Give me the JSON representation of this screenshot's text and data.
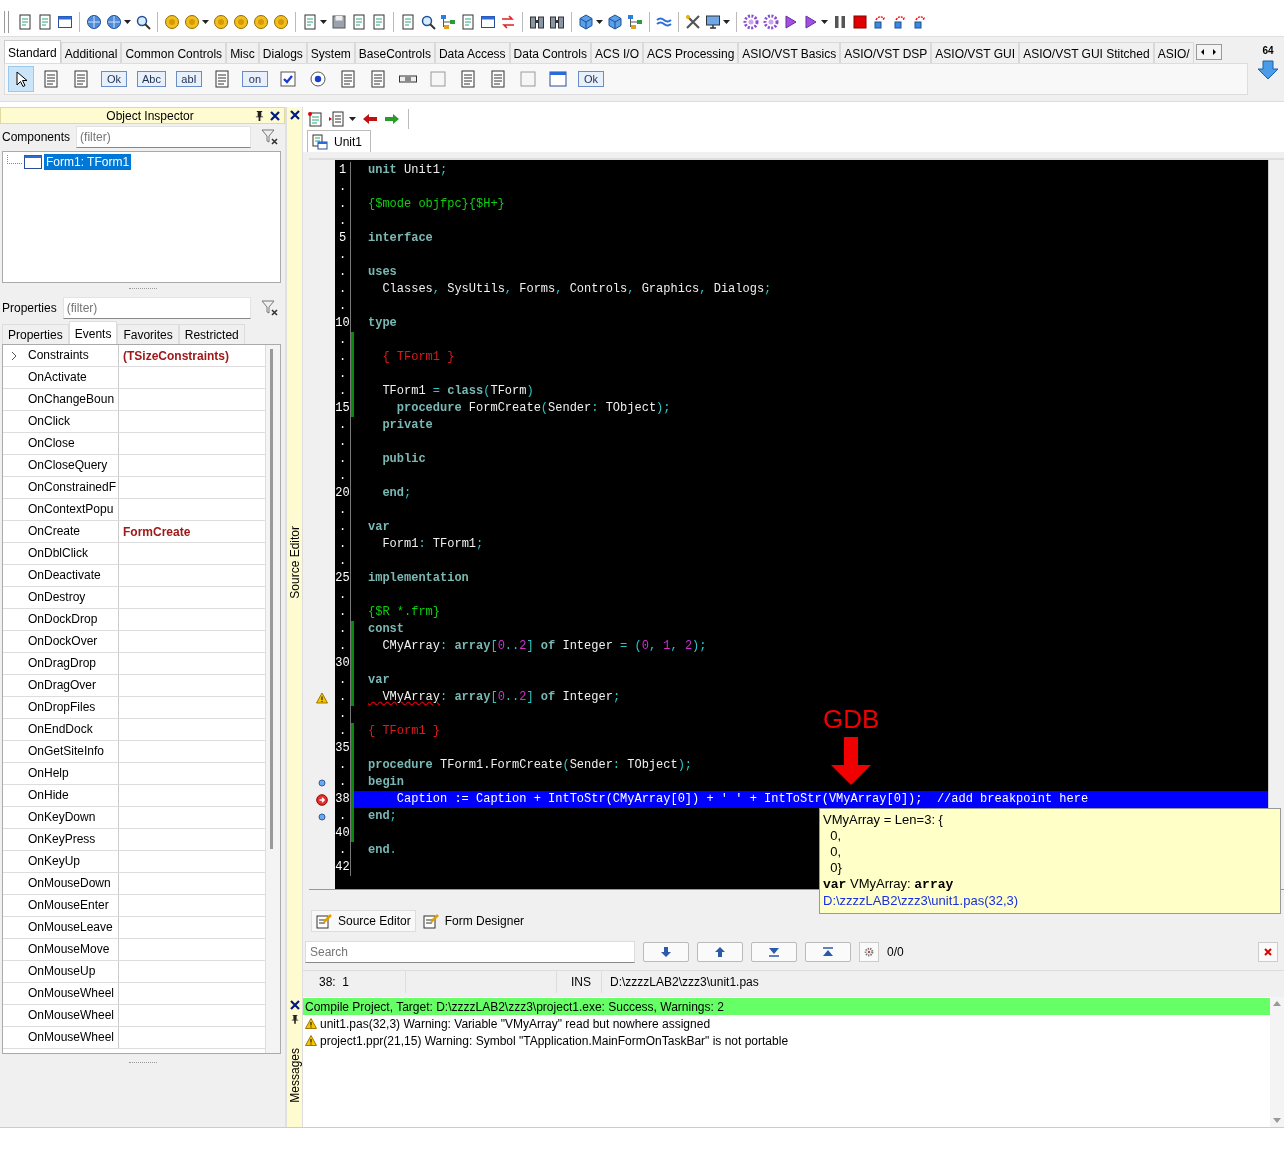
{
  "toolbar": {
    "badge": "64"
  },
  "palette": {
    "tabs": [
      {
        "label": "Standard",
        "selected": true
      },
      {
        "label": "Additional",
        "selected": false
      },
      {
        "label": "Common Controls",
        "selected": false
      },
      {
        "label": "Misc",
        "selected": false
      },
      {
        "label": "Dialogs",
        "selected": false
      },
      {
        "label": "System",
        "selected": false
      },
      {
        "label": "BaseControls",
        "selected": false
      },
      {
        "label": "Data Access",
        "selected": false
      },
      {
        "label": "Data Controls",
        "selected": false
      },
      {
        "label": "ACS I/O",
        "selected": false
      },
      {
        "label": "ACS Processing",
        "selected": false
      },
      {
        "label": "ASIO/VST Basics",
        "selected": false
      },
      {
        "label": "ASIO/VST DSP",
        "selected": false
      },
      {
        "label": "ASIO/VST GUI",
        "selected": false
      },
      {
        "label": "ASIO/VST GUI Stitched",
        "selected": false
      },
      {
        "label": "ASIO/",
        "selected": false
      }
    ],
    "components": [
      {
        "kind": "pointer",
        "selected": true
      },
      {
        "kind": "menu",
        "selected": false
      },
      {
        "kind": "popup",
        "selected": false
      },
      {
        "kind": "text",
        "label": "Ok",
        "selected": false
      },
      {
        "kind": "text",
        "label": "Abc",
        "selected": false
      },
      {
        "kind": "text",
        "label": "abI",
        "selected": false
      },
      {
        "kind": "memo",
        "selected": false
      },
      {
        "kind": "text",
        "label": "on",
        "selected": false
      },
      {
        "kind": "checkbox",
        "selected": false
      },
      {
        "kind": "radio",
        "selected": false
      },
      {
        "kind": "list",
        "selected": false
      },
      {
        "kind": "menu",
        "selected": false
      },
      {
        "kind": "scrollbar",
        "selected": false
      },
      {
        "kind": "panel",
        "selected": false
      },
      {
        "kind": "list",
        "selected": false
      },
      {
        "kind": "list",
        "selected": false
      },
      {
        "kind": "panel",
        "selected": false
      },
      {
        "kind": "window",
        "selected": false
      },
      {
        "kind": "text",
        "label": "Ok",
        "selected": false
      }
    ]
  },
  "object_inspector": {
    "title": "Object Inspector",
    "components_label": "Components",
    "components_filter": {
      "placeholder": "(filter)"
    },
    "tree": [
      {
        "label": "Form1: TForm1",
        "selected": true
      }
    ],
    "properties_label": "Properties",
    "properties_filter": {
      "placeholder": "(filter)"
    },
    "tabs": [
      {
        "label": "Properties",
        "selected": false
      },
      {
        "label": "Events",
        "selected": true
      },
      {
        "label": "Favorites",
        "selected": false
      },
      {
        "label": "Restricted",
        "selected": false
      }
    ],
    "rows": [
      {
        "kind": "group",
        "name": "Constraints",
        "value": "(TSizeConstraints)"
      },
      {
        "kind": "event",
        "name": "OnActivate"
      },
      {
        "kind": "event",
        "name": "OnChangeBoun"
      },
      {
        "kind": "event",
        "name": "OnClick"
      },
      {
        "kind": "event",
        "name": "OnClose"
      },
      {
        "kind": "event",
        "name": "OnCloseQuery"
      },
      {
        "kind": "event",
        "name": "OnConstrainedF"
      },
      {
        "kind": "event",
        "name": "OnContextPopu"
      },
      {
        "kind": "event",
        "name": "OnCreate",
        "value": "FormCreate"
      },
      {
        "kind": "event",
        "name": "OnDblClick"
      },
      {
        "kind": "event",
        "name": "OnDeactivate"
      },
      {
        "kind": "event",
        "name": "OnDestroy"
      },
      {
        "kind": "event",
        "name": "OnDockDrop"
      },
      {
        "kind": "event",
        "name": "OnDockOver"
      },
      {
        "kind": "event",
        "name": "OnDragDrop"
      },
      {
        "kind": "event",
        "name": "OnDragOver"
      },
      {
        "kind": "event",
        "name": "OnDropFiles"
      },
      {
        "kind": "event",
        "name": "OnEndDock"
      },
      {
        "kind": "event",
        "name": "OnGetSiteInfo"
      },
      {
        "kind": "event",
        "name": "OnHelp"
      },
      {
        "kind": "event",
        "name": "OnHide"
      },
      {
        "kind": "event",
        "name": "OnKeyDown"
      },
      {
        "kind": "event",
        "name": "OnKeyPress"
      },
      {
        "kind": "event",
        "name": "OnKeyUp"
      },
      {
        "kind": "event",
        "name": "OnMouseDown"
      },
      {
        "kind": "event",
        "name": "OnMouseEnter"
      },
      {
        "kind": "event",
        "name": "OnMouseLeave"
      },
      {
        "kind": "event",
        "name": "OnMouseMove"
      },
      {
        "kind": "event",
        "name": "OnMouseUp"
      },
      {
        "kind": "event",
        "name": "OnMouseWheel"
      },
      {
        "kind": "event",
        "name": "OnMouseWheel"
      },
      {
        "kind": "event",
        "name": "OnMouseWheel"
      }
    ]
  },
  "source_editor": {
    "side_label": "Source Editor",
    "tabs": [
      {
        "label": "Unit1",
        "selected": true
      }
    ],
    "lines": [
      {
        "gutter": "1",
        "kind": "plain",
        "modified": false,
        "highlighted": false,
        "tokens": [
          {
            "kind": "keyword",
            "text": "unit"
          },
          {
            "kind": "ident",
            "text": " Unit1"
          },
          {
            "kind": "symbol",
            "text": ";"
          }
        ]
      },
      {
        "gutter": ".",
        "kind": "plain",
        "modified": false,
        "highlighted": false
      },
      {
        "gutter": ".",
        "kind": "plain",
        "modified": false,
        "highlighted": false,
        "tokens": [
          {
            "kind": "directive",
            "text": "{$mode objfpc}{$H+}"
          }
        ]
      },
      {
        "gutter": ".",
        "kind": "plain",
        "modified": false,
        "highlighted": false
      },
      {
        "gutter": "5",
        "kind": "plain",
        "modified": false,
        "highlighted": false,
        "tokens": [
          {
            "kind": "keyword",
            "text": "interface"
          }
        ]
      },
      {
        "gutter": ".",
        "kind": "plain",
        "modified": false,
        "highlighted": false
      },
      {
        "gutter": ".",
        "kind": "plain",
        "modified": false,
        "highlighted": false,
        "tokens": [
          {
            "kind": "keyword",
            "text": "uses"
          }
        ]
      },
      {
        "gutter": ".",
        "kind": "plain",
        "modified": false,
        "highlighted": false,
        "tokens": [
          {
            "kind": "ident",
            "text": "  Classes"
          },
          {
            "kind": "symbol",
            "text": ", "
          },
          {
            "kind": "ident",
            "text": "SysUtils"
          },
          {
            "kind": "symbol",
            "text": ", "
          },
          {
            "kind": "ident",
            "text": "Forms"
          },
          {
            "kind": "symbol",
            "text": ", "
          },
          {
            "kind": "ident",
            "text": "Controls"
          },
          {
            "kind": "symbol",
            "text": ", "
          },
          {
            "kind": "ident",
            "text": "Graphics"
          },
          {
            "kind": "symbol",
            "text": ", "
          },
          {
            "kind": "ident",
            "text": "Dialogs"
          },
          {
            "kind": "symbol",
            "text": ";"
          }
        ]
      },
      {
        "gutter": ".",
        "kind": "plain",
        "modified": false,
        "highlighted": false
      },
      {
        "gutter": "10",
        "kind": "plain",
        "modified": false,
        "highlighted": false,
        "tokens": [
          {
            "kind": "keyword",
            "text": "type"
          }
        ]
      },
      {
        "gutter": ".",
        "kind": "plain",
        "modified": true,
        "highlighted": false
      },
      {
        "gutter": ".",
        "kind": "plain",
        "modified": true,
        "highlighted": false,
        "tokens": [
          {
            "kind": "comment",
            "text": "  { TForm1 }"
          }
        ]
      },
      {
        "gutter": ".",
        "kind": "plain",
        "modified": true,
        "highlighted": false
      },
      {
        "gutter": ".",
        "kind": "plain",
        "modified": true,
        "highlighted": false,
        "tokens": [
          {
            "kind": "ident",
            "text": "  TForm1 "
          },
          {
            "kind": "symbol",
            "text": "= "
          },
          {
            "kind": "keyword",
            "text": "class"
          },
          {
            "kind": "symbol",
            "text": "("
          },
          {
            "kind": "ident",
            "text": "TForm"
          },
          {
            "kind": "symbol",
            "text": ")"
          }
        ]
      },
      {
        "gutter": "15",
        "kind": "plain",
        "modified": true,
        "highlighted": false,
        "tokens": [
          {
            "kind": "keyword",
            "text": "    procedure"
          },
          {
            "kind": "ident",
            "text": " FormCreate"
          },
          {
            "kind": "symbol",
            "text": "("
          },
          {
            "kind": "ident",
            "text": "Sender"
          },
          {
            "kind": "symbol",
            "text": ":"
          },
          {
            "kind": "ident",
            "text": " TObject"
          },
          {
            "kind": "symbol",
            "text": ");"
          }
        ]
      },
      {
        "gutter": ".",
        "kind": "plain",
        "modified": false,
        "highlighted": false,
        "tokens": [
          {
            "kind": "keyword",
            "text": "  private"
          }
        ]
      },
      {
        "gutter": ".",
        "kind": "plain",
        "modified": false,
        "highlighted": false
      },
      {
        "gutter": ".",
        "kind": "plain",
        "modified": false,
        "highlighted": false,
        "tokens": [
          {
            "kind": "keyword",
            "text": "  public"
          }
        ]
      },
      {
        "gutter": ".",
        "kind": "plain",
        "modified": false,
        "highlighted": false
      },
      {
        "gutter": "20",
        "kind": "plain",
        "modified": false,
        "highlighted": false,
        "tokens": [
          {
            "kind": "keyword",
            "text": "  end"
          },
          {
            "kind": "symbol",
            "text": ";"
          }
        ]
      },
      {
        "gutter": ".",
        "kind": "plain",
        "modified": false,
        "highlighted": false
      },
      {
        "gutter": ".",
        "kind": "plain",
        "modified": false,
        "highlighted": false,
        "tokens": [
          {
            "kind": "keyword",
            "text": "var"
          }
        ]
      },
      {
        "gutter": ".",
        "kind": "plain",
        "modified": false,
        "highlighted": false,
        "tokens": [
          {
            "kind": "ident",
            "text": "  Form1"
          },
          {
            "kind": "symbol",
            "text": ":"
          },
          {
            "kind": "ident",
            "text": " TForm1"
          },
          {
            "kind": "symbol",
            "text": ";"
          }
        ]
      },
      {
        "gutter": ".",
        "kind": "plain",
        "modified": false,
        "highlighted": false
      },
      {
        "gutter": "25",
        "kind": "plain",
        "modified": false,
        "highlighted": false,
        "tokens": [
          {
            "kind": "keyword",
            "text": "implementation"
          }
        ]
      },
      {
        "gutter": ".",
        "kind": "plain",
        "modified": false,
        "highlighted": false
      },
      {
        "gutter": ".",
        "kind": "plain",
        "modified": false,
        "highlighted": false,
        "tokens": [
          {
            "kind": "directive",
            "text": "{$R *.frm}"
          }
        ]
      },
      {
        "gutter": ".",
        "kind": "plain",
        "modified": true,
        "highlighted": false,
        "tokens": [
          {
            "kind": "keyword",
            "text": "const"
          }
        ]
      },
      {
        "gutter": ".",
        "kind": "plain",
        "modified": true,
        "highlighted": false,
        "tokens": [
          {
            "kind": "ident",
            "text": "  CMyArray"
          },
          {
            "kind": "symbol",
            "text": ": "
          },
          {
            "kind": "keyword",
            "text": "array"
          },
          {
            "kind": "symbol",
            "text": "["
          },
          {
            "kind": "number",
            "text": "0"
          },
          {
            "kind": "symbol",
            "text": ".."
          },
          {
            "kind": "number",
            "text": "2"
          },
          {
            "kind": "symbol",
            "text": "] "
          },
          {
            "kind": "keyword",
            "text": "of"
          },
          {
            "kind": "ident",
            "text": " Integer "
          },
          {
            "kind": "symbol",
            "text": "= ("
          },
          {
            "kind": "number",
            "text": "0"
          },
          {
            "kind": "symbol",
            "text": ", "
          },
          {
            "kind": "number",
            "text": "1"
          },
          {
            "kind": "symbol",
            "text": ", "
          },
          {
            "kind": "number",
            "text": "2"
          },
          {
            "kind": "symbol",
            "text": ");"
          }
        ]
      },
      {
        "gutter": "30",
        "kind": "plain",
        "modified": true,
        "highlighted": false
      },
      {
        "gutter": ".",
        "kind": "plain",
        "modified": true,
        "highlighted": false,
        "tokens": [
          {
            "kind": "keyword",
            "text": "var"
          }
        ]
      },
      {
        "gutter": ".",
        "kind": "warning",
        "modified": true,
        "highlighted": false,
        "tokens": [
          {
            "kind": "flagged",
            "text": "  VMyArray"
          },
          {
            "kind": "symbol",
            "text": ": "
          },
          {
            "kind": "keyword",
            "text": "array"
          },
          {
            "kind": "symbol",
            "text": "["
          },
          {
            "kind": "number",
            "text": "0"
          },
          {
            "kind": "symbol",
            "text": ".."
          },
          {
            "kind": "number",
            "text": "2"
          },
          {
            "kind": "symbol",
            "text": "] "
          },
          {
            "kind": "keyword",
            "text": "of"
          },
          {
            "kind": "ident",
            "text": " Integer"
          },
          {
            "kind": "symbol",
            "text": ";"
          }
        ]
      },
      {
        "gutter": ".",
        "kind": "plain",
        "modified": false,
        "highlighted": false
      },
      {
        "gutter": ".",
        "kind": "plain",
        "modified": true,
        "highlighted": false,
        "tokens": [
          {
            "kind": "comment",
            "text": "{ TForm1 }"
          }
        ]
      },
      {
        "gutter": "35",
        "kind": "plain",
        "modified": true,
        "highlighted": false
      },
      {
        "gutter": ".",
        "kind": "plain",
        "modified": true,
        "highlighted": false,
        "tokens": [
          {
            "kind": "keyword",
            "text": "procedure"
          },
          {
            "kind": "ident",
            "text": " TForm1.FormCreate"
          },
          {
            "kind": "symbol",
            "text": "("
          },
          {
            "kind": "ident",
            "text": "Sender"
          },
          {
            "kind": "symbol",
            "text": ":"
          },
          {
            "kind": "ident",
            "text": " TObject"
          },
          {
            "kind": "symbol",
            "text": ");"
          }
        ]
      },
      {
        "gutter": ".",
        "kind": "executable",
        "modified": true,
        "highlighted": false,
        "tokens": [
          {
            "kind": "keyword",
            "text": "begin"
          }
        ]
      },
      {
        "gutter": "38",
        "kind": "breakpoint",
        "modified": true,
        "highlighted": true,
        "tokens": [
          {
            "kind": "ident",
            "text": "    Caption := Caption + IntToStr(CMyArray[0]) + ' ' + IntToStr(VMyArray[0]);  //add breakpoint here"
          }
        ]
      },
      {
        "gutter": ".",
        "kind": "executable",
        "modified": true,
        "highlighted": false,
        "tokens": [
          {
            "kind": "keyword",
            "text": "end"
          },
          {
            "kind": "symbol",
            "text": ";"
          }
        ]
      },
      {
        "gutter": "40",
        "kind": "plain",
        "modified": true,
        "highlighted": false
      },
      {
        "gutter": ".",
        "kind": "plain",
        "modified": false,
        "highlighted": false,
        "tokens": [
          {
            "kind": "keyword",
            "text": "end"
          },
          {
            "kind": "symbol",
            "text": "."
          }
        ]
      },
      {
        "gutter": "42",
        "kind": "plain",
        "modified": false,
        "highlighted": false
      }
    ],
    "annotation": {
      "label": "GDB"
    },
    "tooltip": {
      "lines": [
        "VMyArray = Len=3: {",
        "  0,",
        "  0,",
        "  0}"
      ],
      "declaration": "**var** VMyArray: **array**",
      "location": "D:\\zzzzLAB2\\zzz3\\unit1.pas(32,3)"
    },
    "view_tabs": [
      {
        "label": "Source Editor",
        "selected": true
      },
      {
        "label": "Form Designer",
        "selected": false
      }
    ],
    "search": {
      "placeholder": "Search",
      "count": "0/0"
    },
    "status": {
      "position": "38:  1",
      "mode": "INS",
      "file": "D:\\zzzzLAB2\\zzz3\\unit1.pas"
    }
  },
  "messages": {
    "side_label": "Messages",
    "items": [
      {
        "kind": "success",
        "text": "Compile Project, Target: D:\\zzzzLAB2\\zzz3\\project1.exe: Success, Warnings: 2"
      },
      {
        "kind": "warning",
        "text": "unit1.pas(32,3) Warning: Variable \"VMyArray\" read but nowhere assigned"
      },
      {
        "kind": "warning",
        "text": "project1.ppr(21,15) Warning: Symbol \"TApplication.MainFormOnTaskBar\" is not portable"
      }
    ]
  }
}
